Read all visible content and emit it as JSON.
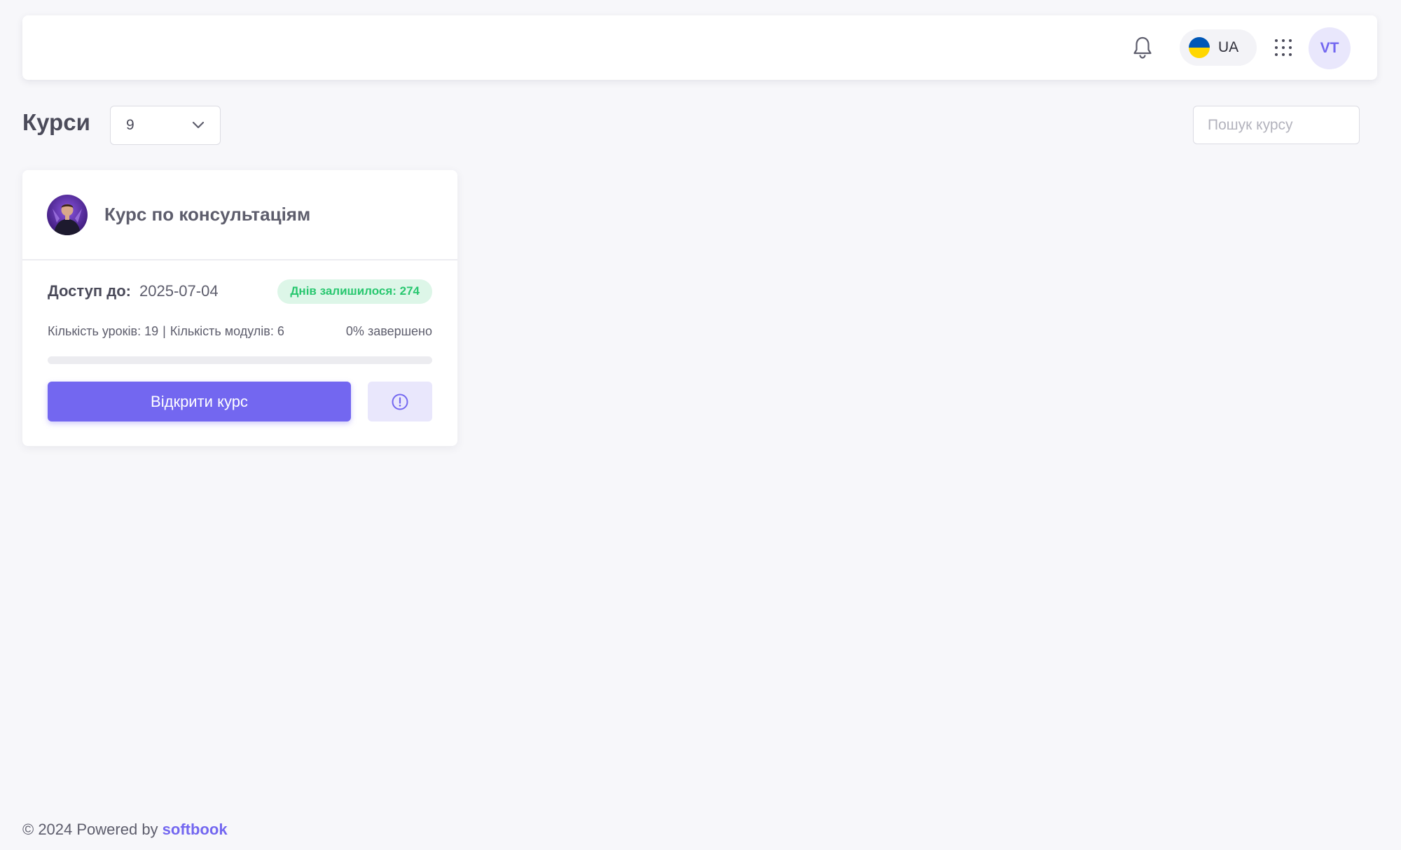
{
  "header": {
    "language": {
      "label": "UA",
      "flag_colors": [
        "#0057b7",
        "#ffd700"
      ]
    },
    "user_initials": "VT",
    "icons": [
      "bell-icon",
      "apps-grid-icon"
    ]
  },
  "courses_page": {
    "title": "Курси",
    "page_size_select": {
      "value": "9"
    },
    "search": {
      "placeholder": "Пошук курсу",
      "value": ""
    }
  },
  "course_card": {
    "title": "Курс по консультаціям",
    "access_label": "Доступ до:",
    "access_date": "2025-07-04",
    "days_left_badge": "Днів залишилося: 274",
    "lessons_text": "Кількість уроків: 19",
    "separator": "|",
    "modules_text": "Кількість модулів: 6",
    "completion_text": "0% завершено",
    "progress_percent": 0,
    "open_button_label": "Відкрити курс"
  },
  "footer": {
    "prefix": "© 2024 Powered by ",
    "brand": "softbook"
  },
  "colors": {
    "primary": "#7367f0",
    "primary_light": "#e9e7fc",
    "success": "#28c76f",
    "success_light": "#ddf6e8",
    "background": "#f7f7fa"
  }
}
